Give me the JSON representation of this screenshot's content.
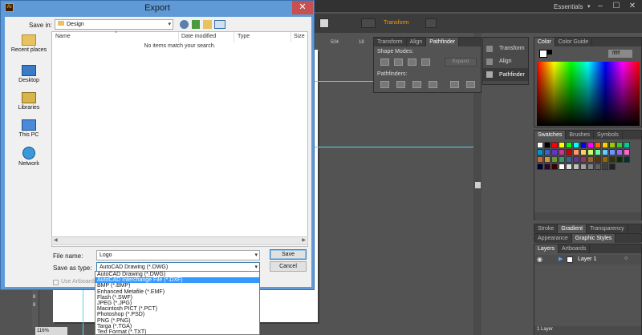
{
  "illustrator": {
    "app_icon": "Ai",
    "workspace": "Essentials",
    "control_bar": {
      "transform_label": "Transform"
    },
    "ruler": {
      "marks": [
        "504",
        "18"
      ]
    },
    "zoom": "116%",
    "left_ruler": [
      "8",
      "8"
    ],
    "transform_panel": {
      "tabs": [
        "Transform",
        "Align",
        "Pathfinder"
      ],
      "shape_modes_label": "Shape Modes:",
      "expand_label": "Expand",
      "pathfinders_label": "Pathfinders:"
    },
    "collapsed_panels": [
      "Transform",
      "Align",
      "Pathfinder"
    ],
    "color_panel": {
      "tabs": [
        "Color",
        "Color Guide"
      ],
      "hex": "ffffff"
    },
    "swatches_panel": {
      "tabs": [
        "Swatches",
        "Brushes",
        "Symbols"
      ]
    },
    "stroke_panel": {
      "tabs": [
        "Stroke",
        "Gradient",
        "Transparency"
      ]
    },
    "appearance_panel": {
      "tabs": [
        "Appearance",
        "Graphic Styles"
      ]
    },
    "layers_panel": {
      "tabs": [
        "Layers",
        "Artboards"
      ],
      "layer_name": "Layer 1",
      "footer": "1 Layer"
    },
    "colors": {
      "accent_orange": "#f39c12",
      "guide_cyan": "#5ad3e6"
    },
    "swatch_colors": [
      "#ffffff",
      "#000000",
      "#ff0000",
      "#ffff00",
      "#00ff00",
      "#00ffff",
      "#0000ff",
      "#ff00ff",
      "#ff6600",
      "#ffcc00",
      "#99cc00",
      "#33cc33",
      "#00cc99",
      "#0099cc",
      "#3366cc",
      "#6633cc",
      "#cc3399",
      "#cc0000",
      "#ff9966",
      "#ffcc66",
      "#ccff66",
      "#66ff99",
      "#66ccff",
      "#6699ff",
      "#9966ff",
      "#ff66cc",
      "#cc6633",
      "#cc9933",
      "#669933",
      "#339966",
      "#336699",
      "#663399",
      "#993366",
      "#996633",
      "#663300",
      "#996600",
      "#333300",
      "#003300",
      "#003333",
      "#000033",
      "#330033",
      "#330000",
      "#ffffff",
      "#e0e0e0",
      "#c0c0c0",
      "#a0a0a0",
      "#808080",
      "#606060",
      "#404040",
      "#202020"
    ]
  },
  "dialog": {
    "title": "Export",
    "close_glyph": "✕",
    "save_in_label": "Save in:",
    "save_in_value": "Design",
    "places": [
      "Recent places",
      "Desktop",
      "Libraries",
      "This PC",
      "Network"
    ],
    "columns": [
      "Name",
      "Date modified",
      "Type",
      "Size"
    ],
    "empty_message": "No items match your search.",
    "file_name_label": "File name:",
    "file_name_value": "Logo",
    "save_as_type_label": "Save as type:",
    "save_as_type_value": "AutoCAD Drawing (*.DWG)",
    "save_button": "Save",
    "cancel_button": "Cancel",
    "use_artboards_label": "Use Artboards",
    "type_options": [
      "AutoCAD Drawing (*.DWG)",
      "AutoCAD Interchange File (*.DXF)",
      "BMP (*.BMP)",
      "Enhanced Metafile (*.EMF)",
      "Flash (*.SWF)",
      "JPEG (*.JPG)",
      "Macintosh PICT (*.PCT)",
      "Photoshop (*.PSD)",
      "PNG (*.PNG)",
      "Targa (*.TGA)",
      "Text Format (*.TXT)"
    ],
    "selected_option_index": 1
  }
}
